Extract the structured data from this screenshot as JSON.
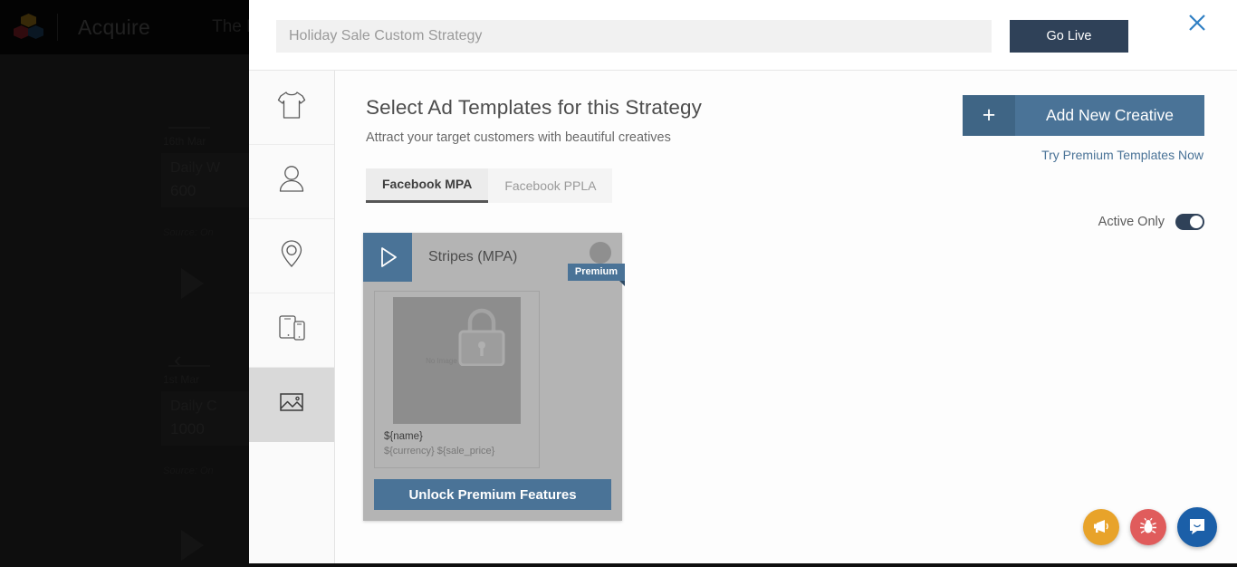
{
  "background_app": {
    "brand": "Acquire",
    "account": "The Pasta",
    "logo_icon": "hexagon-cluster-logo",
    "cards": [
      {
        "date": "16th Mar",
        "title": "Daily W",
        "value": "600",
        "source": "Source: On"
      },
      {
        "date": "1st Mar",
        "title": "Daily C",
        "value": "1000",
        "source": "Source: On"
      }
    ]
  },
  "modal": {
    "top_bar": {
      "strategy_name_value": "",
      "strategy_name_placeholder": "Holiday Sale Custom Strategy",
      "go_live_label": "Go Live",
      "close_icon": "close-x-icon"
    },
    "rail": {
      "items": [
        {
          "icon": "tshirt-icon",
          "name": "products",
          "active": false
        },
        {
          "icon": "person-icon",
          "name": "audience",
          "active": false
        },
        {
          "icon": "location-pin-icon",
          "name": "locations",
          "active": false
        },
        {
          "icon": "devices-icon",
          "name": "placements",
          "active": false
        },
        {
          "icon": "image-icon",
          "name": "creatives",
          "active": true
        }
      ]
    },
    "main": {
      "title": "Select Ad Templates for this Strategy",
      "subtitle": "Attract your target customers with beautiful creatives",
      "add_creative_label": "Add New Creative",
      "add_creative_plus": "+",
      "try_premium_label": "Try Premium Templates Now",
      "tabs": [
        {
          "label": "Facebook MPA",
          "active": true
        },
        {
          "label": "Facebook PPLA",
          "active": false
        }
      ],
      "active_only": {
        "label": "Active Only",
        "state": "on"
      },
      "cards": [
        {
          "title": "Stripes (MPA)",
          "badge": "Premium",
          "play_icon": "play-triangle-icon",
          "menu_icon": "circle-menu-icon",
          "preview": {
            "placeholder_text": "No Image Available",
            "lock_icon": "lock-icon",
            "name_token": "${name}",
            "price_token": "${currency} ${sale_price}"
          },
          "unlock_label": "Unlock Premium Features"
        }
      ]
    }
  },
  "fabs": [
    {
      "name": "announcement-fab",
      "icon": "megaphone-icon",
      "color": "#e8a32a"
    },
    {
      "name": "report-bug-fab",
      "icon": "bug-icon",
      "color": "#e05c5c"
    },
    {
      "name": "chat-fab",
      "icon": "chat-bubble-icon",
      "color": "#1b5fa8"
    }
  ],
  "colors": {
    "accent_blue": "#4a7397",
    "navy": "#2f4158",
    "link_blue": "#4a7397"
  }
}
